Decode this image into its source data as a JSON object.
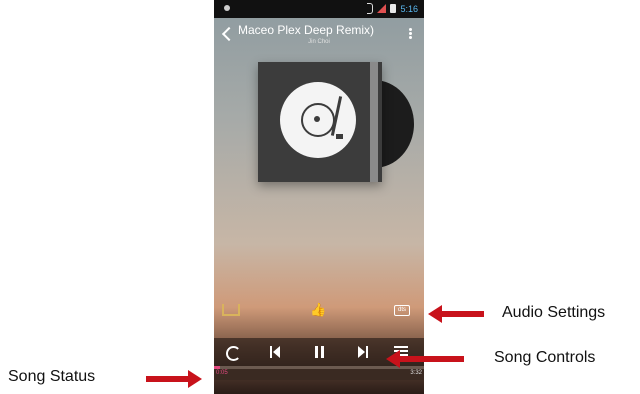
{
  "status_bar": {
    "time": "5:16"
  },
  "header": {
    "title": "Maceo Plex Deep Remix)",
    "artist": "Jin Choi"
  },
  "album": {
    "icon": "turntable-icon"
  },
  "actions": {
    "sleep_icon": "sleep-timer-icon",
    "like_icon": "thumbs-up-icon",
    "audio_effect_label": "dts"
  },
  "controls": {
    "repeat_icon": "repeat-icon",
    "prev_icon": "previous-icon",
    "play_pause_icon": "pause-icon",
    "next_icon": "next-icon",
    "playlist_icon": "playlist-icon"
  },
  "progress": {
    "elapsed": "0:05",
    "total": "3:32",
    "fraction": 0.03
  },
  "annotations": {
    "audio_settings": "Audio Settings",
    "song_controls": "Song Controls",
    "song_status": "Song Status"
  },
  "colors": {
    "arrow": "#c8121b",
    "progress_accent": "#e24a80",
    "clock": "#5ab8f0"
  }
}
